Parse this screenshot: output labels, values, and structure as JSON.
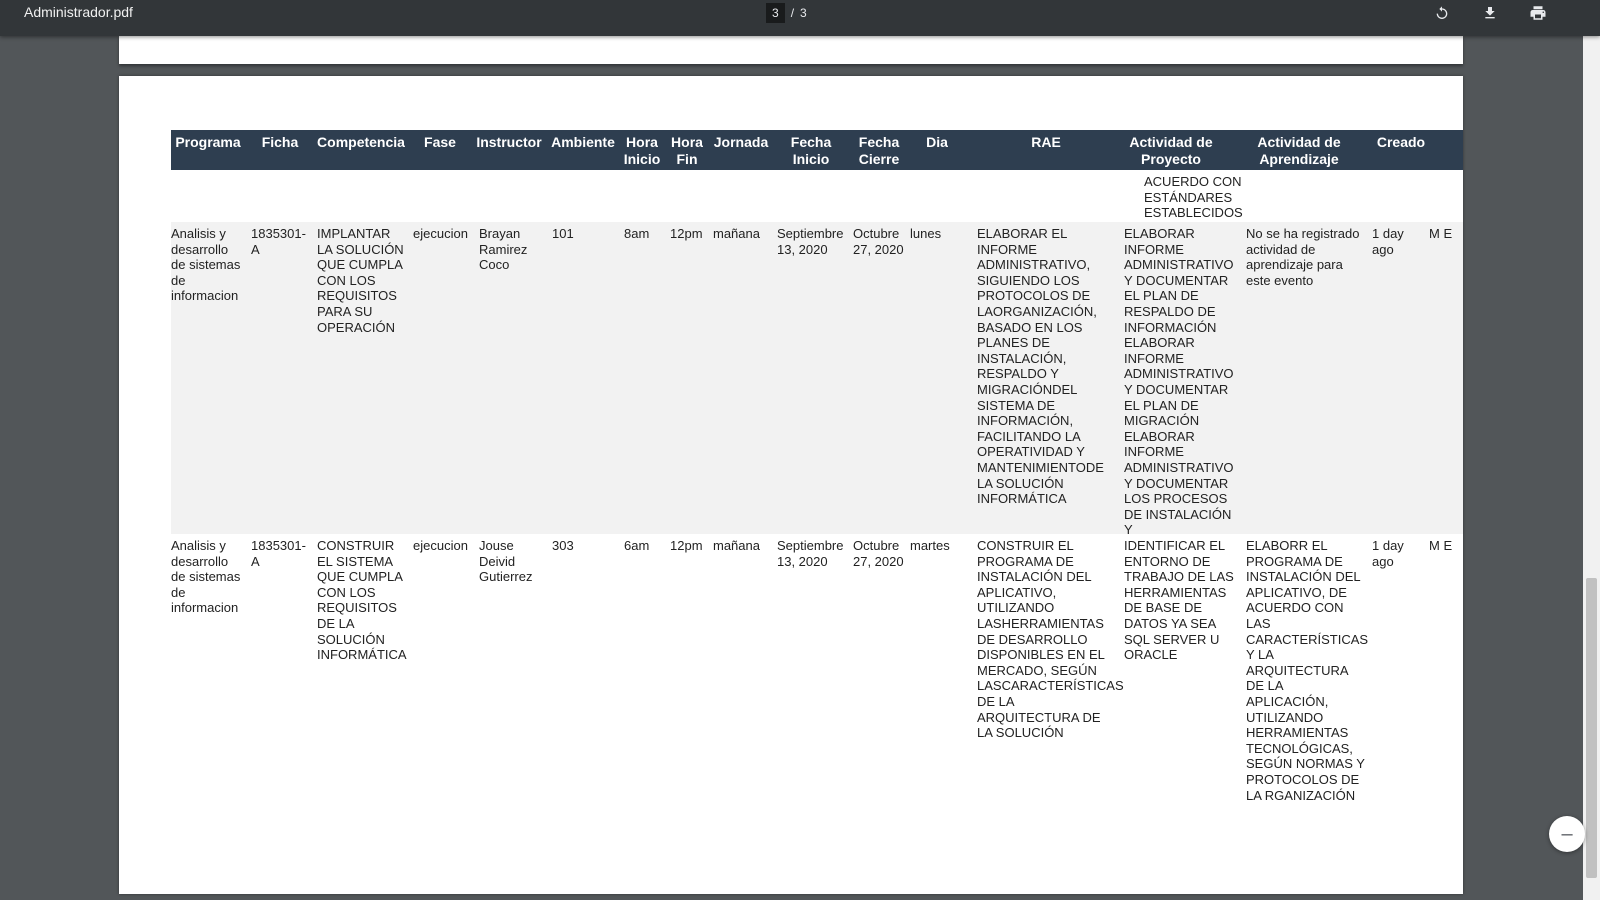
{
  "viewer": {
    "title": "Administrador.pdf",
    "current_page": "3",
    "page_separator": "/",
    "total_pages": "3",
    "zoom_out_label": "–"
  },
  "table": {
    "headers": [
      "Programa",
      "Ficha",
      "Competencia",
      "Fase",
      "Instructor",
      "Ambiente",
      "Hora Inicio",
      "Hora Fin",
      "Jornada",
      "Fecha Inicio",
      "Fecha Cierre",
      "Dia",
      "RAE",
      "Actividad de Proyecto",
      "Actividad de Aprendizaje",
      "Creado"
    ],
    "continuation": "ACUERDO CON ESTÁNDARES ESTABLECIDOS",
    "rows": [
      {
        "programa": "Analisis y desarrollo de sistemas de informacion",
        "ficha": "1835301-A",
        "competencia": "IMPLANTAR LA SOLUCIÓN QUE CUMPLA CON LOS REQUISITOS PARA SU OPERACIÓN",
        "fase": "ejecucion",
        "instructor": "Brayan Ramirez Coco",
        "ambiente": "101",
        "hora_inicio": "8am",
        "hora_fin": "12pm",
        "jornada": "mañana",
        "fecha_inicio": "Septiembre 13, 2020",
        "fecha_cierre": "Octubre 27, 2020",
        "dia": "lunes",
        "rae": "ELABORAR EL INFORME ADMINISTRATIVO, SIGUIENDO LOS PROTOCOLOS DE LAORGANIZACIÓN, BASADO EN LOS PLANES DE INSTALACIÓN, RESPALDO Y MIGRACIÓNDEL SISTEMA DE INFORMACIÓN, FACILITANDO LA OPERATIVIDAD Y MANTENIMIENTODE LA SOLUCIÓN INFORMÁTICA",
        "actividad_proyecto": "ELABORAR INFORME ADMINISTRATIVO Y DOCUMENTAR EL PLAN DE RESPALDO DE INFORMACIÓN ELABORAR INFORME ADMINISTRATIVO Y DOCUMENTAR EL PLAN DE MIGRACIÓN ELABORAR INFORME ADMINISTRATIVO Y DOCUMENTAR LOS PROCESOS DE INSTALACIÓN Y CONFIGURACIÓN",
        "actividad_aprendizaje": "No se ha registrado actividad de aprendizaje para este evento",
        "creado": "1 day ago",
        "partial": "M E"
      },
      {
        "programa": "Analisis y desarrollo de sistemas de informacion",
        "ficha": "1835301-A",
        "competencia": "CONSTRUIR EL SISTEMA QUE CUMPLA CON LOS REQUISITOS DE LA SOLUCIÓN INFORMÁTICA",
        "fase": "ejecucion",
        "instructor": "Jouse Deivid Gutierrez",
        "ambiente": "303",
        "hora_inicio": "6am",
        "hora_fin": "12pm",
        "jornada": "mañana",
        "fecha_inicio": "Septiembre 13, 2020",
        "fecha_cierre": "Octubre 27, 2020",
        "dia": "martes",
        "rae": "CONSTRUIR EL PROGRAMA DE INSTALACIÓN DEL APLICATIVO, UTILIZANDO LASHERRAMIENTAS DE DESARROLLO DISPONIBLES EN EL MERCADO, SEGÚN LASCARACTERÍSTICAS DE LA ARQUITECTURA DE LA SOLUCIÓN",
        "actividad_proyecto": "IDENTIFICAR EL ENTORNO DE TRABAJO DE LAS HERRAMIENTAS DE BASE DE DATOS YA SEA SQL SERVER U ORACLE",
        "actividad_aprendizaje": "ELABORR EL PROGRAMA DE INSTALACIÓN DEL APLICATIVO, DE ACUERDO CON LAS CARACTERÍSTICAS Y LA ARQUITECTURA DE LA APLICACIÓN, UTILIZANDO HERRAMIENTAS TECNOLÓGICAS, SEGÚN NORMAS Y PROTOCOLOS DE LA RGANIZACIÓN",
        "creado": "1 day ago",
        "partial": "M E"
      }
    ]
  }
}
